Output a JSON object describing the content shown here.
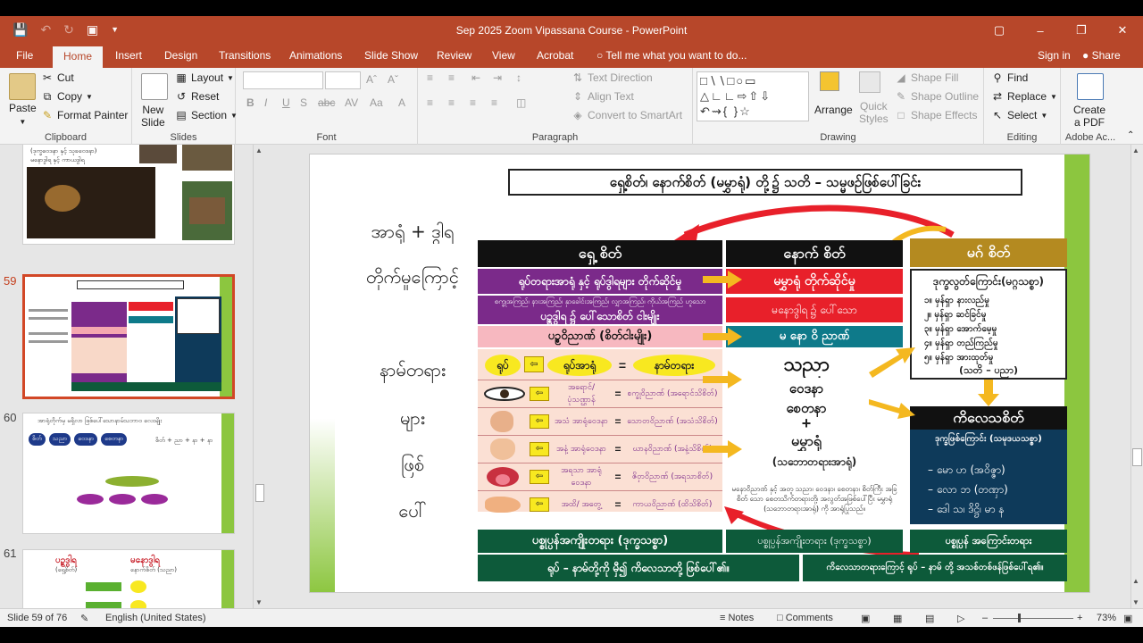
{
  "window": {
    "title": "Sep 2025 Zoom Vipassana Course - PowerPoint"
  },
  "tabs": [
    "File",
    "Home",
    "Insert",
    "Design",
    "Transitions",
    "Animations",
    "Slide Show",
    "Review",
    "View",
    "Acrobat"
  ],
  "active_tab": "Home",
  "tell_me": "Tell me what you want to do...",
  "account": {
    "signin": "Sign in",
    "share": "Share"
  },
  "ribbon": {
    "clipboard": {
      "label": "Clipboard",
      "paste": "Paste",
      "cut": "Cut",
      "copy": "Copy",
      "format_painter": "Format Painter"
    },
    "slides": {
      "label": "Slides",
      "new_slide": "New\nSlide",
      "layout": "Layout",
      "reset": "Reset",
      "section": "Section"
    },
    "font": {
      "label": "Font"
    },
    "paragraph": {
      "label": "Paragraph",
      "text_direction": "Text Direction",
      "align_text": "Align Text",
      "convert_smartart": "Convert to SmartArt"
    },
    "drawing": {
      "label": "Drawing",
      "arrange": "Arrange",
      "quick_styles": "Quick\nStyles",
      "shape_fill": "Shape Fill",
      "shape_outline": "Shape Outline",
      "shape_effects": "Shape Effects"
    },
    "editing": {
      "label": "Editing",
      "find": "Find",
      "replace": "Replace",
      "select": "Select"
    },
    "adobe": {
      "label": "Adobe Ac...",
      "create_pdf": "Create\na PDF"
    }
  },
  "thumbnails": [
    {
      "number": "",
      "line1": "(ဒုက္ခဝေဒနာ နှင့် သုခဝေဒနာ)",
      "line2": "မနောဒွါရ နှင့် ကာယဒွါရ"
    },
    {
      "number": "59",
      "selected": true
    },
    {
      "number": "60",
      "title": "အာရုံတိုက်မှ မရှိလာ ဖြစ်ပေါ်သောနာမ်သဘာဝ လေးမျိုး",
      "chain": [
        "စိတ်",
        "သညာ",
        "ဝေဒနာ",
        "စေတနာ"
      ],
      "formula": "စိတ် + ညာ + နာ + နာ"
    },
    {
      "number": "61",
      "left": "ပဉ္စဒွါရ",
      "left_sub": "(ရှေ့စိတ်)",
      "right": "မနောဒွါရ",
      "right_sub": "နောက်စိတ် (သညာ)"
    }
  ],
  "slide": {
    "title": "ရှေ့စိတ်၊ နောက်စိတ် (မမွှာရုံ) တို့၌ သတိ – သမ္မဖဉ်ဖြစ်ပေါ်ခြင်း",
    "left_text": [
      "အာရုံ + ဒွါရ",
      "တိုက်မှုကြောင့်",
      "နာမ်တရား",
      "များ",
      "ဖြစ်",
      "ပေါ်"
    ],
    "col_headers": [
      "ရှေ့ စိတ်",
      "နောက် စိတ်",
      "မဂ် စိတ်"
    ],
    "col1": {
      "r1": "ရုပ်တရားအာရုံ နှင့် ရုပ်ဒွါရများ တိုက်ဆိုင်မှု",
      "r2a": "စက္ခုအကြည်၊ နားအကြည်၊ နှာခေါင်းအကြည်၊ လျှာအကြည်၊ ကိုယ်အကြည် ဟူသော",
      "r2b": "ပဉ္စဒွါရ ၌ ပေါ်သောစိတ် ငါးမျိုး",
      "r3": "ပဉ္စဝိညာဏ် (စိတ်ငါးမျိုး)",
      "eq": [
        "ရုပ်",
        "ရုပ်အာရုံ",
        "=",
        "နာမ်တရား"
      ],
      "senses": [
        {
          "icon": "eye",
          "base": "အရောင်/ ပုံသဏ္ဌာန်",
          "result": "စက္ခုဝိညာဏ် (အရောင်သိစိတ်)"
        },
        {
          "icon": "ear",
          "base": "အသံ အာရုံဝေဒနာ",
          "result": "သောတဝိညာဏ် (အသံသိစိတ်)"
        },
        {
          "icon": "nose",
          "base": "အနံ့ အာရုံဝေဒနာ",
          "result": "ဃာနဝိညာဏ် (အနံ့သိစိတ်)"
        },
        {
          "icon": "tongue",
          "base": "အရသာ အာရုံဝေဒနာ",
          "result": "ဇိဝှာဝိညာဏ် (အရသာစိတ်)"
        },
        {
          "icon": "hand",
          "base": "အထိ/ အတွေ့",
          "result": "ကာယဝိညာဏ် (ထိသိစိတ်)"
        }
      ],
      "footer": "ပစ္စုပ္ပန်အကျိုးတရား (ဒုက္ခသစ္စာ)"
    },
    "col2": {
      "r1": "မမွှာရုံ တိုက်ဆိုင်မှု",
      "r2": "မနောဒွါရ ၌ ပေါ်သော",
      "r3": "မ နော ဝိ ညာဏ်",
      "center": [
        "သညာ",
        "ဝေဒနာ",
        "စေတနာ",
        "+",
        "မမွှာရုံ",
        "(သဘောတရားအာရုံ)"
      ],
      "note": "မနောဝိညာဏ် နှင့် အတူ သညာ၊ ဝေဒနာ၊ စေတနာ၊ စိတ်ကြီး အခြ စိတ် သော စေတသိက်တရားတို့၊ အလွတ်အဖြစ်ပေါ်ပြီး မမွှာရုံ (သဘောတရားအာရုံ) ကို အာရုံပြုသည်။",
      "footer": "ပစ္စုပ္ပန်အကျိုးတရား (ဒုက္ခသစ္စာ)"
    },
    "col3": {
      "box_title": "ဒုက္ခလွတ်ကြောင်း(မဂ္ဂသစ္စာ)",
      "items": [
        "၁။ မှန်ရှာ နားလည်မှု",
        "၂။ မှန်ရှာ ဆင်ခြင်မှု",
        "၃။ မှန်ရှာ အောက်မေ့မှု",
        "၄။ မှန်ရှာ တည်ကြည်မှု",
        "၅။ မှန်ရှာ အားထုတ်မှု"
      ],
      "box_foot": "(သတိ – ပညာ)",
      "k_header": "ကိလေသစိတ်",
      "k_sub": "ဒုက္ခဖြစ်ကြောင်း (သမုဒယသစ္စာ)",
      "k_items": [
        "– မော ဟ (အဝိဇ္ဇာ)",
        "– လော ဘ (တဏှာ)",
        "– ဒေါ သ၊ ဒိဋ္ဌိ၊ မာ န"
      ],
      "footer": "ပစ္စုပ္ပန် အကြောင်းတရား"
    },
    "bottom_left": "ရုပ် – နာမ်တို့ကို မှီ၍ ကိလေသာတို့ ဖြစ်ပေါ်၏။",
    "bottom_right": "ကိလေသာတရားကြောင့် ရုပ် – နာမ် တို့ အသစ်တစ်ဖန်ဖြစ်ပေါ်ရ၏။"
  },
  "status": {
    "slide_of": "Slide 59 of 76",
    "language": "English (United States)",
    "notes": "Notes",
    "comments": "Comments",
    "zoom": "73%"
  },
  "colors": {
    "brand": "#b7472a",
    "purple": "#7b2a8a",
    "red": "#e8202a",
    "teal": "#0e7a8a",
    "dark_green": "#0d5a3a",
    "navy": "#0e3a5a",
    "gold": "#c8a020"
  }
}
